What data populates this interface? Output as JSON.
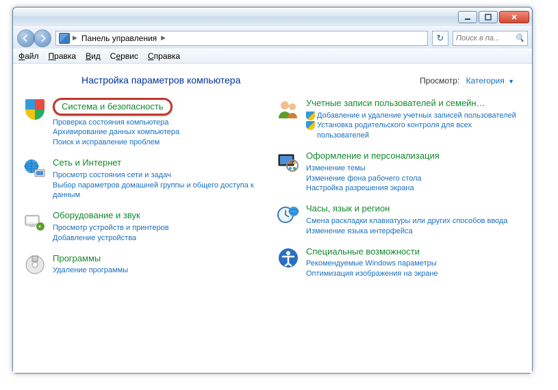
{
  "titlebar": {
    "minimize": "–",
    "maximize": "□",
    "close": "×"
  },
  "breadcrumb": {
    "root": "Панель управления",
    "sep": "▶"
  },
  "search": {
    "placeholder": "Поиск в па..."
  },
  "menu": {
    "file": "Файл",
    "edit": "Правка",
    "view": "Вид",
    "tools": "Сервис",
    "help": "Справка"
  },
  "heading": "Настройка параметров компьютера",
  "view": {
    "label": "Просмотр:",
    "mode": "Категория",
    "dd": "▼"
  },
  "left": [
    {
      "title": "Система и безопасность",
      "highlight": true,
      "icon": "shield",
      "subs": [
        {
          "t": "Проверка состояния компьютера"
        },
        {
          "t": "Архивирование данных компьютера"
        },
        {
          "t": "Поиск и исправление проблем"
        }
      ]
    },
    {
      "title": "Сеть и Интернет",
      "icon": "net",
      "subs": [
        {
          "t": "Просмотр состояния сети и задач"
        },
        {
          "t": "Выбор параметров домашней группы и общего доступа к данным"
        }
      ]
    },
    {
      "title": "Оборудование и звук",
      "icon": "hw",
      "subs": [
        {
          "t": "Просмотр устройств и принтеров"
        },
        {
          "t": "Добавление устройства"
        }
      ]
    },
    {
      "title": "Программы",
      "icon": "prog",
      "subs": [
        {
          "t": "Удаление программы"
        }
      ]
    }
  ],
  "right": [
    {
      "title": "Учетные записи пользователей и семейн…",
      "icon": "users",
      "subs": [
        {
          "t": "Добавление и удаление учетных записей пользователей",
          "s": true
        },
        {
          "t": "Установка родительского контроля для всех пользователей",
          "s": true
        }
      ]
    },
    {
      "title": "Оформление и персонализация",
      "icon": "appearance",
      "subs": [
        {
          "t": "Изменение темы"
        },
        {
          "t": "Изменение фона рабочего стола"
        },
        {
          "t": "Настройка разрешения экрана"
        }
      ]
    },
    {
      "title": "Часы, язык и регион",
      "icon": "clock",
      "subs": [
        {
          "t": "Смена раскладки клавиатуры или других способов ввода"
        },
        {
          "t": "Изменение языка интерфейса"
        }
      ]
    },
    {
      "title": "Специальные возможности",
      "icon": "ease",
      "subs": [
        {
          "t": "Рекомендуемые Windows параметры"
        },
        {
          "t": "Оптимизация изображения на экране"
        }
      ]
    }
  ]
}
